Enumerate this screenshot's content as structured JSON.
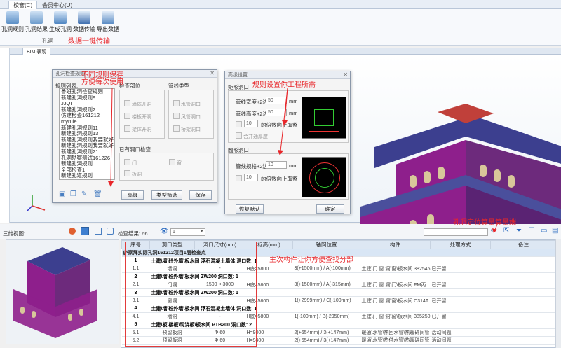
{
  "ribbon": {
    "tabs": [
      "校審(C)",
      "会员中心(U)"
    ],
    "buttons": [
      "孔洞规则",
      "孔洞结果",
      "生成孔洞",
      "数据传输",
      "导出数据"
    ],
    "group_label": "孔洞",
    "note_transfer": "数据一键传输"
  },
  "bim_tab": "BIM 表现",
  "rules_dialog": {
    "title": "孔洞检查规则",
    "list_label": "规则列表:",
    "rules": [
      "鲁班孔洞检查规则",
      "新建孔洞规则9",
      "JJQI",
      "新建孔洞规则2",
      "仿建检查161212",
      "myrule",
      "新建孔洞规则11",
      "新建孔洞规则13",
      "新建孔洞规则我要就好字...",
      "新建孔洞规则我要就好字...",
      "新建孔洞规则21",
      "孔洞勘察测试161226",
      "新建孔洞规则",
      "全部检查1",
      "新建孔道规则"
    ],
    "check_part_label": "检查部位",
    "pipe_type_label": "管线类型",
    "check_items": [
      "墙体开洞",
      "楼板开洞",
      "梁体开洞"
    ],
    "pipe_items": [
      "水管洞口",
      "风管洞口",
      "桥架洞口"
    ],
    "existing_label": "已有洞口检查",
    "existing_items": [
      "门",
      "窗",
      "板洞"
    ],
    "buttons": [
      "高级",
      "类型筛选",
      "保存"
    ],
    "note": "不同规则保存\n方便每次使用"
  },
  "adv_dialog": {
    "title": "高级设置",
    "rect_label": "矩形洞口",
    "rect_fields": [
      {
        "label": "管线宽度+2边边",
        "value": "50",
        "unit": "mm"
      },
      {
        "label": "管线高度+2边边",
        "value": "50",
        "unit": "mm"
      }
    ],
    "rect_round": {
      "value": "10",
      "label": "的倍数向上取整"
    },
    "merge_label": "合并通厚度",
    "round_label": "圆形洞口",
    "round_field": {
      "label": "管线规格+2边边",
      "value": "10",
      "unit": "mm"
    },
    "round_round": {
      "value": "10",
      "label": "的倍数向上取整"
    },
    "restore_btn": "恢复默认",
    "ok_btn": "确定",
    "note": "规则设置你工程所需"
  },
  "lower": {
    "view_label": "三维视图:",
    "check_count": "检查结果: 66",
    "dropdown": "1",
    "note_locate": "孔洞定位算量算量端",
    "note_find": "主次构件让你方便查找分部"
  },
  "table": {
    "headers": [
      "序号",
      "洞口类型",
      "洞口尺寸(mm)",
      "标高(mm)",
      "轴网位置",
      "构件",
      "处理方式",
      "备注"
    ],
    "top_row": "庐家拜实际孔洞161212项目1层检查点",
    "rows": [
      {
        "kind": "group",
        "cells": [
          "1",
          "土建\\墙\\砼外墙\\板水间 浮石混凝土墙体 洞口数: 1",
          "",
          "",
          "",
          "",
          "",
          ""
        ]
      },
      {
        "kind": "sub",
        "cells": [
          "1.1",
          "墙洞",
          "-",
          "H底=5800",
          "3(+1500mm) / A(-100mm)",
          "土建\\门 窗 洞\\窗\\板水间 382546",
          "已开留",
          ""
        ]
      },
      {
        "kind": "group",
        "cells": [
          "2",
          "土建\\墙\\砼外墙\\板水间 ZW200 洞口数: 1",
          "",
          "",
          "",
          "",
          "",
          ""
        ]
      },
      {
        "kind": "sub",
        "cells": [
          "2.1",
          "门洞",
          "1500 × 3000",
          "H底=5800",
          "3(+1500mm) / A(-315mm)",
          "土建\\门 窗 洞\\门\\板水间 FM丙",
          "已开留",
          ""
        ]
      },
      {
        "kind": "group",
        "cells": [
          "3",
          "土建\\墙\\砼外墙\\板水间 ZW200 洞口数: 1",
          "",
          "",
          "",
          "",
          "",
          ""
        ]
      },
      {
        "kind": "sub",
        "cells": [
          "3.1",
          "窗洞",
          "-",
          "H底=5800",
          "1(+2999mm) / C(-100mm)",
          "土建\\门 窗 洞\\窗\\板水间 C314T",
          "已开留",
          ""
        ]
      },
      {
        "kind": "group",
        "cells": [
          "4",
          "土建\\墙\\砼外墙\\板水间 浮石混凝土墙体 洞口数: 1",
          "",
          "",
          "",
          "",
          "",
          ""
        ]
      },
      {
        "kind": "sub",
        "cells": [
          "4.1",
          "墙洞",
          "-",
          "H底=5800",
          "1(-100mm) / B(-2950mm)",
          "土建\\门 窗 洞\\窗\\板水间 385250",
          "已开留",
          ""
        ]
      },
      {
        "kind": "group",
        "cells": [
          "5",
          "土建\\板\\楼板\\现浇板\\板水间 PTB200 洞口数: 2",
          "",
          "",
          "",
          "",
          "",
          ""
        ]
      },
      {
        "kind": "sub",
        "cells": [
          "5.1",
          "预留板洞",
          "Φ 60",
          "H=9400",
          "2(+654mm) / 3(+147mm)",
          "暖通\\水管\\热回水管\\热暖碎间管",
          "活动间题",
          ""
        ]
      },
      {
        "kind": "sub",
        "cells": [
          "5.2",
          "预留板洞",
          "Φ 60",
          "H=9400",
          "2(+654mm) / 3(+147mm)",
          "暖通\\水管\\热供水管\\热暖碎间管",
          "活动间题",
          ""
        ]
      }
    ]
  },
  "colors": {
    "accent": "#e8262a",
    "status_green": "#1f8f2a",
    "building_purple": "#8e1f8c",
    "roof_blue": "#4a4f9c"
  }
}
